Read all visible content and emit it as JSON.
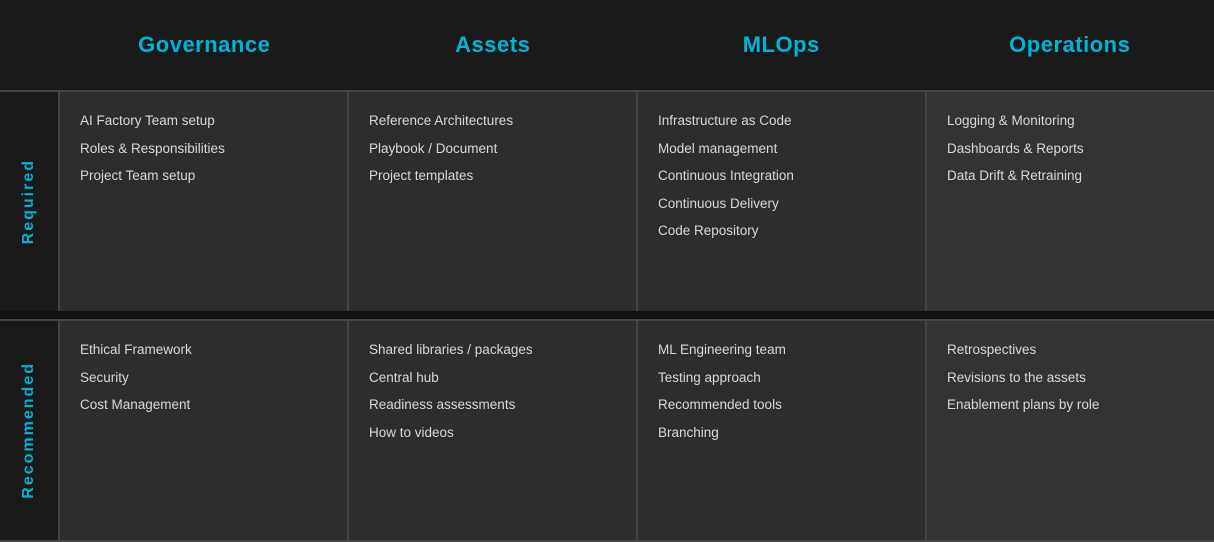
{
  "header": {
    "columns": [
      {
        "label": "Governance"
      },
      {
        "label": "Assets"
      },
      {
        "label": "MLOps"
      },
      {
        "label": "Operations"
      }
    ]
  },
  "sections": [
    {
      "id": "required",
      "label": "Required",
      "cells": [
        {
          "col": "governance",
          "items": [
            "AI Factory Team setup",
            "Roles & Responsibilities",
            "Project Team setup"
          ]
        },
        {
          "col": "assets",
          "items": [
            "Reference Architectures",
            "Playbook / Document",
            "Project templates"
          ]
        },
        {
          "col": "mlops",
          "items": [
            "Infrastructure as Code",
            "Model management",
            "Continuous Integration",
            "Continuous Delivery",
            "Code Repository"
          ]
        },
        {
          "col": "operations",
          "items": [
            "Logging & Monitoring",
            "Dashboards & Reports",
            "Data Drift & Retraining"
          ]
        }
      ]
    },
    {
      "id": "recommended",
      "label": "Recommended",
      "cells": [
        {
          "col": "governance",
          "items": [
            "Ethical Framework",
            "Security",
            "Cost Management"
          ]
        },
        {
          "col": "assets",
          "items": [
            "Shared libraries / packages",
            "Central hub",
            "Readiness assessments",
            "How to videos"
          ]
        },
        {
          "col": "mlops",
          "items": [
            "ML Engineering team",
            "Testing approach",
            "Recommended tools",
            "Branching"
          ]
        },
        {
          "col": "operations",
          "items": [
            "Retrospectives",
            "Revisions to the assets",
            "Enablement plans by role"
          ]
        }
      ]
    }
  ]
}
